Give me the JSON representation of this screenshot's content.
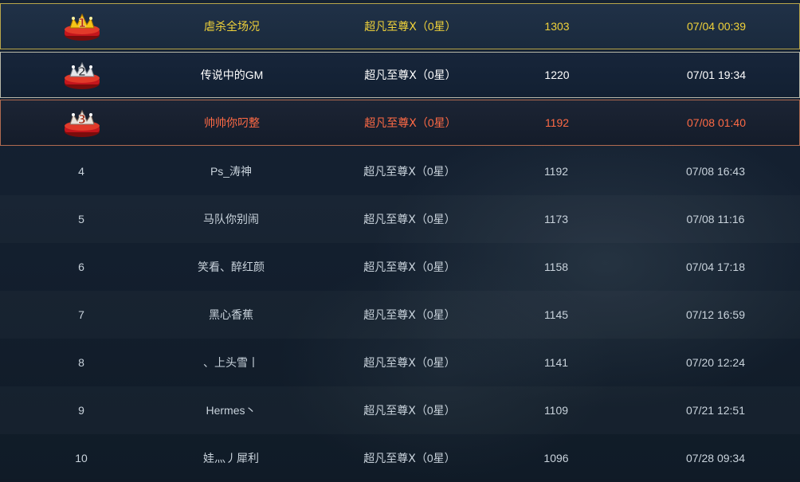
{
  "colors": {
    "first_place_text": "#f0d23a",
    "second_place_text": "#ffffff",
    "third_place_text": "#ff6a45",
    "default_text": "#c9d3dc",
    "first_place_border": "#b9a64a",
    "second_place_border": "#b8b8a8",
    "third_place_border": "#b06a50"
  },
  "leaderboard": {
    "rows": [
      {
        "rank": "1",
        "medal_icon": "gold-medal-1-icon",
        "name": "虐杀全场况",
        "tier": "超凡至尊Ⅹ（0星）",
        "score": "1303",
        "time": "07/04 00:39"
      },
      {
        "rank": "2",
        "medal_icon": "silver-medal-2-icon",
        "name": "传说中的GM",
        "tier": "超凡至尊Ⅹ（0星）",
        "score": "1220",
        "time": "07/01 19:34"
      },
      {
        "rank": "3",
        "medal_icon": "bronze-medal-3-icon",
        "name": "帅帅你叼整",
        "tier": "超凡至尊Ⅹ（0星）",
        "score": "1192",
        "time": "07/08 01:40"
      },
      {
        "rank": "4",
        "name": "Ps_涛神",
        "tier": "超凡至尊Ⅹ（0星）",
        "score": "1192",
        "time": "07/08 16:43"
      },
      {
        "rank": "5",
        "name": "马队你别闹",
        "tier": "超凡至尊Ⅹ（0星）",
        "score": "1173",
        "time": "07/08 11:16"
      },
      {
        "rank": "6",
        "name": "笑看、醉红颜",
        "tier": "超凡至尊Ⅹ（0星）",
        "score": "1158",
        "time": "07/04 17:18"
      },
      {
        "rank": "7",
        "name": "黑心香蕉",
        "tier": "超凡至尊Ⅹ（0星）",
        "score": "1145",
        "time": "07/12 16:59"
      },
      {
        "rank": "8",
        "name": "、上头雪丨",
        "tier": "超凡至尊Ⅹ（0星）",
        "score": "1141",
        "time": "07/20 12:24"
      },
      {
        "rank": "9",
        "name": "Hermes丶",
        "tier": "超凡至尊Ⅹ（0星）",
        "score": "1109",
        "time": "07/21 12:51"
      },
      {
        "rank": "10",
        "name": "娃灬丿犀利",
        "tier": "超凡至尊Ⅹ（0星）",
        "score": "1096",
        "time": "07/28 09:34"
      }
    ]
  }
}
